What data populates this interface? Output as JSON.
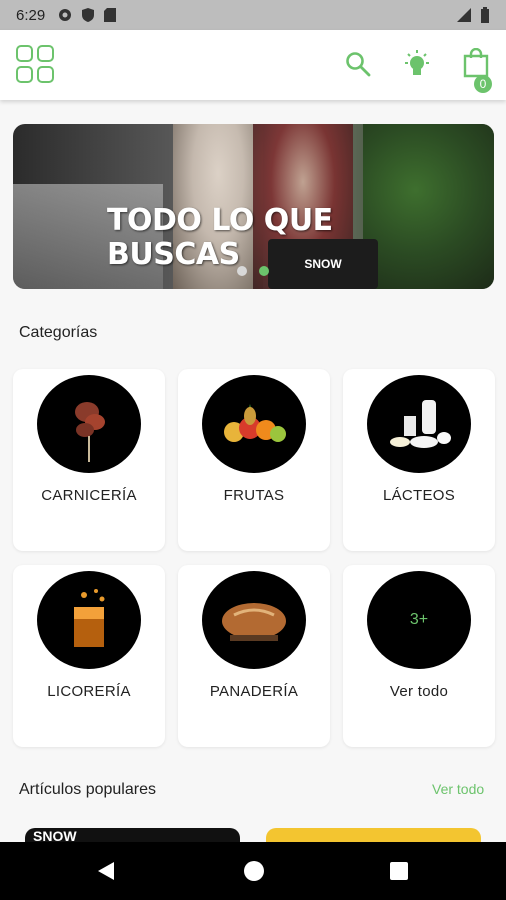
{
  "status_bar": {
    "time": "6:29"
  },
  "cart": {
    "count": "0"
  },
  "banner": {
    "headline_line1": "TODO LO QUE",
    "headline_line2": "BUSCAS",
    "basket_text": "SNOW",
    "slide": "2 of 2"
  },
  "categories": {
    "title": "Categorías",
    "items": [
      {
        "label": "CARNICERÍA",
        "icon": "meat-image"
      },
      {
        "label": "FRUTAS",
        "icon": "fruits-image"
      },
      {
        "label": "LÁCTEOS",
        "icon": "dairy-image"
      },
      {
        "label": "LICORERÍA",
        "icon": "liquor-image"
      },
      {
        "label": "PANADERÍA",
        "icon": "bread-image"
      },
      {
        "label": "Ver todo",
        "icon": "more-badge",
        "more": "3+"
      }
    ]
  },
  "popular": {
    "title": "Artículos populares",
    "see_all": "Ver todo",
    "card1_text": "SNOW"
  },
  "colors": {
    "accent": "#6cc36c",
    "statusbar": "#bdbdbd",
    "navbar": "#000000"
  }
}
